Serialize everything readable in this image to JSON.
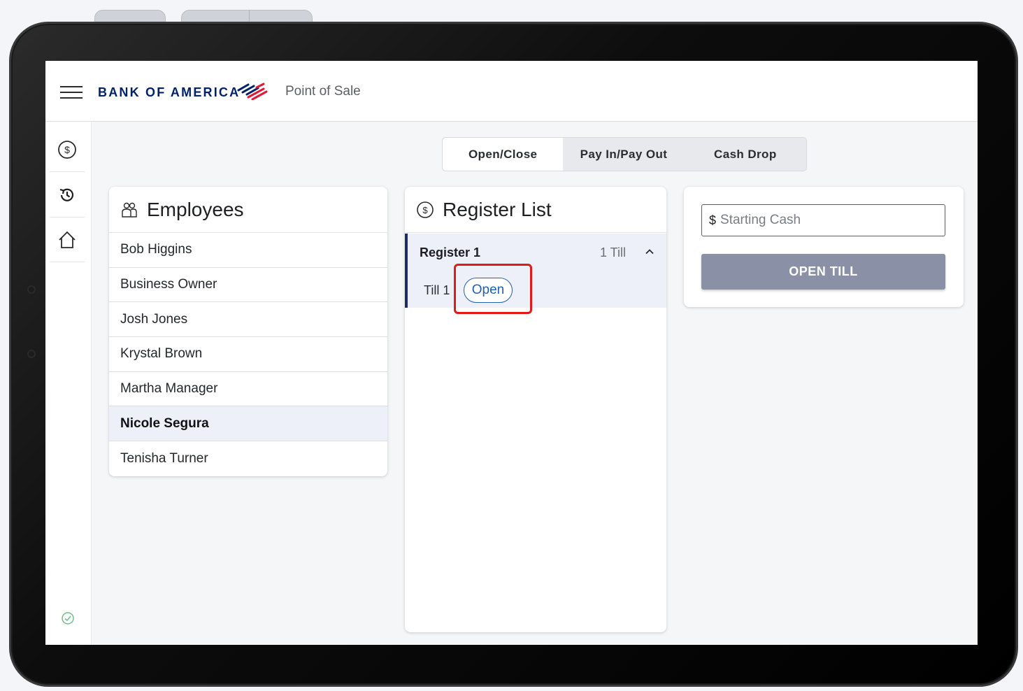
{
  "header": {
    "brand": "BANK OF AMERICA",
    "app_title": "Point of Sale"
  },
  "sidebar": {
    "items": [
      {
        "icon": "dollar-circle-icon"
      },
      {
        "icon": "history-icon"
      },
      {
        "icon": "home-icon"
      }
    ],
    "status_icon": "check-circle-icon"
  },
  "tabs": {
    "items": [
      "Open/Close",
      "Pay In/Pay Out",
      "Cash Drop"
    ],
    "active": "Open/Close"
  },
  "employees": {
    "title": "Employees",
    "list": [
      "Bob Higgins",
      "Business Owner",
      "Josh Jones",
      "Krystal Brown",
      "Martha Manager",
      "Nicole Segura",
      "Tenisha Turner"
    ],
    "selected": "Nicole Segura"
  },
  "registers": {
    "title": "Register List",
    "groups": [
      {
        "name": "Register 1",
        "count": "1 Till",
        "tills": [
          {
            "name": "Till 1",
            "status": "Open"
          }
        ]
      }
    ]
  },
  "cash": {
    "currency_symbol": "$",
    "placeholder": "Starting Cash",
    "button_label": "OPEN TILL"
  },
  "colors": {
    "brand_navy": "#012169",
    "brand_red": "#e31837",
    "accent_blue": "#1f5fb8",
    "button_disabled": "#8a91a7",
    "highlight_red": "#e01919"
  }
}
